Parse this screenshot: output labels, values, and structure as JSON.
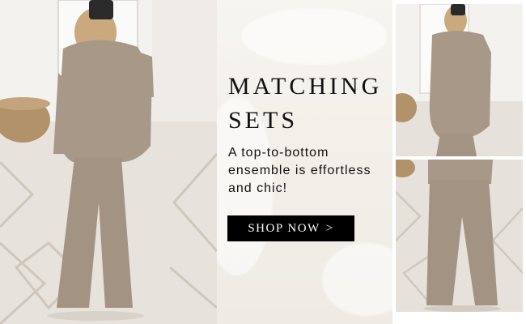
{
  "promo": {
    "headline_line1": "MATCHING",
    "headline_line2": "SETS",
    "subtext": "A top-to-bottom ensemble is effortless and chic!",
    "cta_label": "SHOP NOW",
    "cta_icon": ">"
  },
  "colors": {
    "button_bg": "#000000",
    "button_text": "#ffffff",
    "headline_text": "#111111",
    "outfit_taupe": "#a89888",
    "panel_bg": "#f3f0ea"
  },
  "icons": {
    "cta_chevron": "chevron-right-icon"
  }
}
